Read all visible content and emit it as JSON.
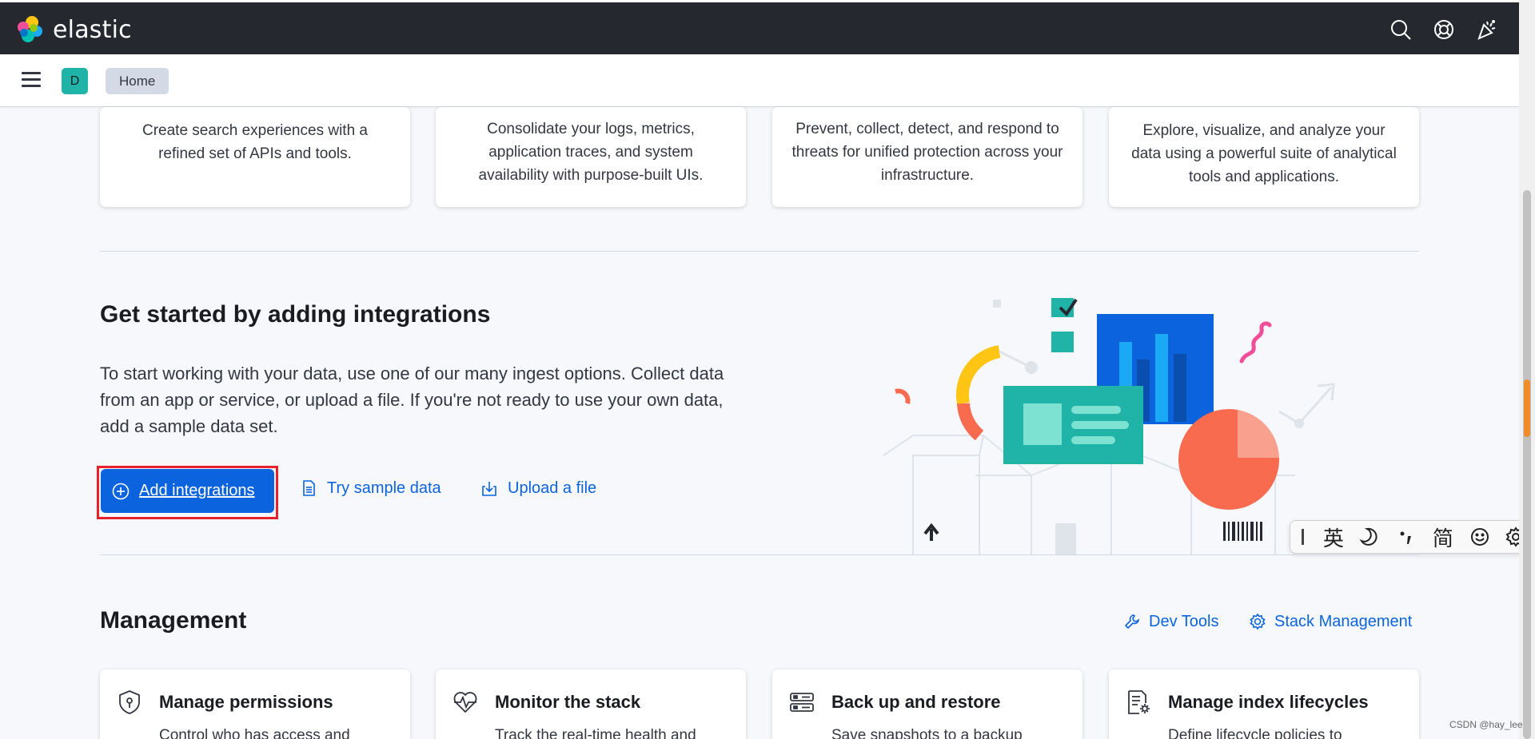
{
  "header": {
    "logo_text": "elastic",
    "icons": [
      "search-icon",
      "help-icon",
      "news-icon"
    ]
  },
  "subheader": {
    "space_initial": "D",
    "breadcrumb": "Home"
  },
  "solution_cards": [
    {
      "description": "Create search experiences with a refined set of APIs and tools."
    },
    {
      "description": "Consolidate your logs, metrics, application traces, and system availability with purpose-built UIs."
    },
    {
      "description": "Prevent, collect, detect, and respond to threats for unified protection across your infrastructure."
    },
    {
      "description": "Explore, visualize, and analyze your data using a powerful suite of analytical tools and applications."
    }
  ],
  "integrations": {
    "title": "Get started by adding integrations",
    "description": "To start working with your data, use one of our many ingest options. Collect data from an app or service, or upload a file. If you're not ready to use your own data, add a sample data set.",
    "add_button": "Add integrations",
    "sample_link": "Try sample data",
    "upload_link": "Upload a file"
  },
  "ime_toolbar": {
    "items": [
      "英",
      "简"
    ]
  },
  "management": {
    "title": "Management",
    "dev_tools": "Dev Tools",
    "stack_management": "Stack Management",
    "cards": [
      {
        "title": "Manage permissions",
        "description": "Control who has access and"
      },
      {
        "title": "Monitor the stack",
        "description": "Track the real-time health and"
      },
      {
        "title": "Back up and restore",
        "description": "Save snapshots to a backup"
      },
      {
        "title": "Manage index lifecycles",
        "description": "Define lifecycle policies to"
      }
    ]
  },
  "watermark": "CSDN @hay_lee",
  "colors": {
    "header_bg": "#25282f",
    "primary": "#0b64dd",
    "highlight_outline": "#e7202b",
    "space_avatar": "#20b3a7"
  }
}
